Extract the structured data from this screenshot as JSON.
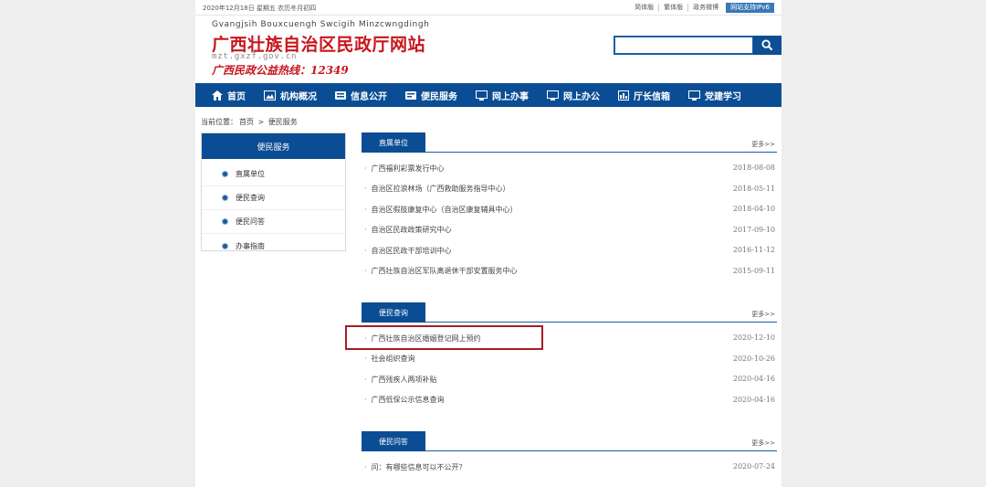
{
  "topbar": {
    "date": "2020年12月18日 星期五 农历冬月初四",
    "links": [
      "简体版",
      "繁体版",
      "政务微博"
    ],
    "accessible": "网站支持IPv6"
  },
  "logo": {
    "pinyin": "Gvangjsih Bouxcuengh Swcigih Minzcwngdingh",
    "title": "广西壮族自治区民政厅网站",
    "domain": "mzt.gxzf.gov.cn",
    "hotline": "广西民政公益热线：12349"
  },
  "search": {
    "placeholder": "",
    "icon": "search-icon"
  },
  "nav": [
    {
      "label": "首页",
      "icon": "home-icon"
    },
    {
      "label": "机构概况",
      "icon": "image-icon"
    },
    {
      "label": "信息公开",
      "icon": "info-icon"
    },
    {
      "label": "便民服务",
      "icon": "service-icon"
    },
    {
      "label": "网上办事",
      "icon": "monitor-icon"
    },
    {
      "label": "网上办公",
      "icon": "monitor-icon"
    },
    {
      "label": "厅长信箱",
      "icon": "chart-icon"
    },
    {
      "label": "党建学习",
      "icon": "monitor-icon"
    }
  ],
  "breadcrumb": {
    "prefix": "当前位置：",
    "home": "首页",
    "sep": ">",
    "current": "便民服务"
  },
  "sidebar": {
    "title": "便民服务",
    "items": [
      "直属单位",
      "便民查询",
      "便民问答",
      "办事指南"
    ]
  },
  "sections": [
    {
      "tab": "直属单位",
      "more": "更多>>",
      "rows": [
        {
          "title": "广西福利彩票发行中心",
          "date": "2018-08-08"
        },
        {
          "title": "自治区拉浪林场（广西救助服务指导中心）",
          "date": "2018-05-11"
        },
        {
          "title": "自治区假肢康复中心（自治区康复辅具中心）",
          "date": "2018-04-10"
        },
        {
          "title": "自治区民政政策研究中心",
          "date": "2017-09-10"
        },
        {
          "title": "自治区民政干部培训中心",
          "date": "2016-11-12"
        },
        {
          "title": "广西壮族自治区军队离退休干部安置服务中心",
          "date": "2015-09-11"
        }
      ]
    },
    {
      "tab": "便民查询",
      "more": "更多>>",
      "rows": [
        {
          "title": "广西壮族自治区婚姻登记网上预约",
          "date": "2020-12-10"
        },
        {
          "title": "社会组织查询",
          "date": "2020-10-26"
        },
        {
          "title": "广西残疾人两项补贴",
          "date": "2020-04-16"
        },
        {
          "title": "广西低保公示信息查询",
          "date": "2020-04-16"
        }
      ]
    },
    {
      "tab": "便民问答",
      "more": "更多>>",
      "rows": [
        {
          "title": "问：有哪些信息可以不公开？",
          "date": "2020-07-24"
        }
      ]
    }
  ],
  "colors": {
    "nav": "#0b4d94",
    "title": "#c8161d",
    "highlight": "#a81c22"
  }
}
